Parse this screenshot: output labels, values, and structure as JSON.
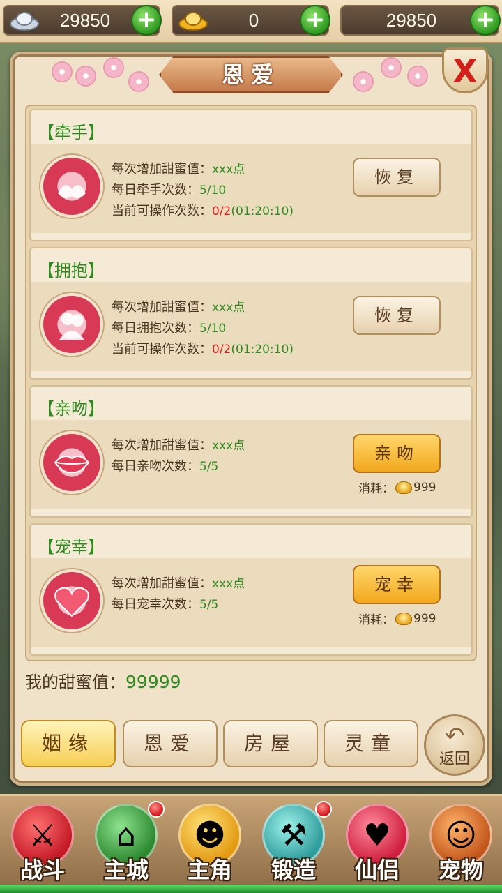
{
  "currency": {
    "silver": "29850",
    "gold": "0",
    "other": "29850"
  },
  "panel": {
    "title": "恩爱",
    "close": "X"
  },
  "cards": [
    {
      "heading": "【牵手】",
      "line1_label": "每次增加甜蜜值：",
      "line1_value": "xxx点",
      "line2_label": "每日牵手次数：",
      "line2_value": "5/10",
      "line3_label": "当前可操作次数：",
      "line3_red": "0/2",
      "line3_time": "(01:20:10)",
      "button": "恢复",
      "icon": "holding-hands-icon"
    },
    {
      "heading": "【拥抱】",
      "line1_label": "每次增加甜蜜值：",
      "line1_value": "xxx点",
      "line2_label": "每日拥抱次数：",
      "line2_value": "5/10",
      "line3_label": "当前可操作次数：",
      "line3_red": "0/2",
      "line3_time": "(01:20:10)",
      "button": "恢复",
      "icon": "hug-icon"
    },
    {
      "heading": "【亲吻】",
      "line1_label": "每次增加甜蜜值：",
      "line1_value": "xxx点",
      "line2_label": "每日亲吻次数：",
      "line2_value": "5/5",
      "button": "亲吻",
      "cost_label": "消耗：",
      "cost_value": "999",
      "icon": "lips-icon"
    },
    {
      "heading": "【宠幸】",
      "line1_label": "每次增加甜蜜值：",
      "line1_value": "xxx点",
      "line2_label": "每日宠幸次数：",
      "line2_value": "5/5",
      "button": "宠幸",
      "cost_label": "消耗：",
      "cost_value": "999",
      "icon": "heart-icon"
    }
  ],
  "sweet": {
    "label": "我的甜蜜值：",
    "value": "99999"
  },
  "tabs": [
    "姻缘",
    "恩爱",
    "房屋",
    "灵童"
  ],
  "back_label": "返回",
  "nav": [
    "战斗",
    "主城",
    "主角",
    "锻造",
    "仙侣",
    "宠物"
  ],
  "colors": {
    "green_text": "#2f8a1f",
    "red_text": "#e01818",
    "gold_button": "#f2a81d"
  }
}
